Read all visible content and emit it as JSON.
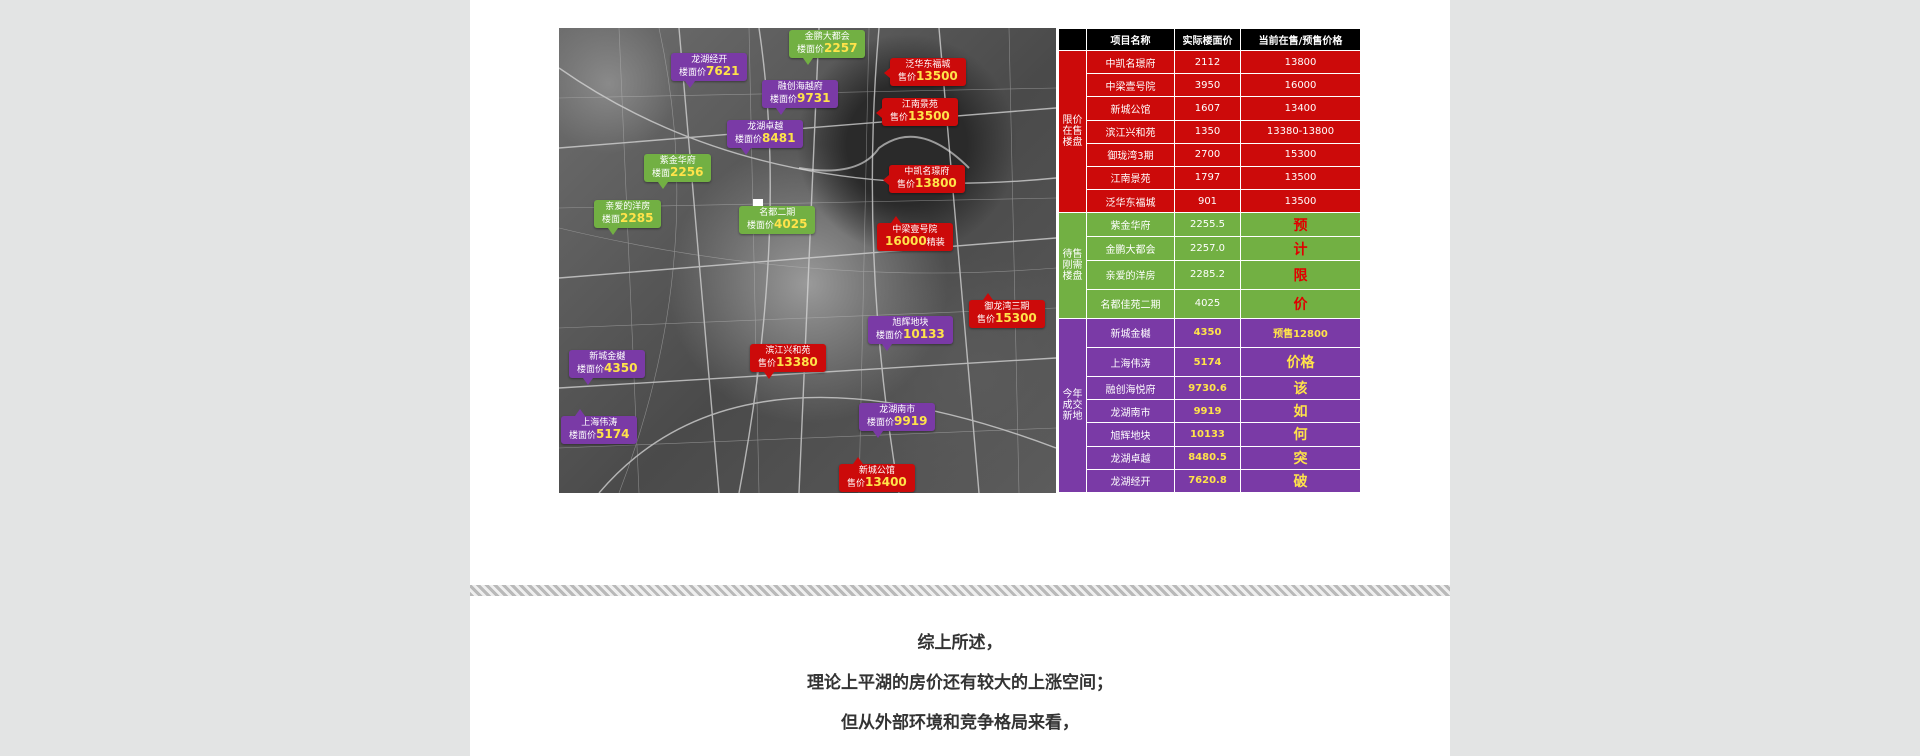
{
  "map": {
    "labels": {
      "jinpeng": {
        "name": "金鹏大都会",
        "value_prefix": "楼面价",
        "value": "2257"
      },
      "longhu_jingkai": {
        "name": "龙湖经开",
        "value_prefix": "楼面价",
        "value": "7621"
      },
      "fanhua": {
        "name": "泛华东福城",
        "value_prefix": "售价",
        "value": "13500"
      },
      "rongchuang": {
        "name": "融创海越府",
        "value_prefix": "楼面价",
        "value": "9731"
      },
      "jiangnan": {
        "name": "江南景苑",
        "value_prefix": "售价",
        "value": "13500"
      },
      "longhu_zhuoyue": {
        "name": "龙湖卓越",
        "value_prefix": "楼面价",
        "value": "8481"
      },
      "zijin": {
        "name": "紫金华府",
        "value_prefix": "楼面",
        "value": "2256"
      },
      "zhongfan": {
        "name": "中凯名璟府",
        "value_prefix": "售价",
        "value": "13800"
      },
      "qinai": {
        "name": "亲爱的洋房",
        "value_prefix": "楼面",
        "value": "2285"
      },
      "mingdu": {
        "name": "名都二期",
        "value_prefix": "楼面价",
        "value": "4025"
      },
      "zhongliang": {
        "name": "中梁壹号院",
        "value": "16000",
        "value_suffix": "精装"
      },
      "yulongwan": {
        "name": "御龙湾三期",
        "value_prefix": "售价",
        "value": "15300"
      },
      "xuhui": {
        "name": "旭辉地块",
        "value_prefix": "楼面价",
        "value": "10133"
      },
      "xincheng_jinye": {
        "name": "新城金樾",
        "value_prefix": "楼面价",
        "value": "4350"
      },
      "binjiang": {
        "name": "滨江兴和苑",
        "value_prefix": "售价",
        "value": "13380"
      },
      "shanghai": {
        "name": "上海伟涛",
        "value_prefix": "楼面价",
        "value": "5174"
      },
      "longhu_nanshi": {
        "name": "龙湖南市",
        "value_prefix": "楼面价",
        "value": "9919"
      },
      "xincheng_gongguan": {
        "name": "新城公馆",
        "value_prefix": "售价",
        "value": "13400"
      }
    }
  },
  "table": {
    "headers": [
      "项目名称",
      "实际楼面价",
      "当前在售/预售价格"
    ],
    "groups": {
      "limited": "限价在售楼盘",
      "pending": "待售刚需楼盘",
      "land": "今年成交新地"
    },
    "rows": [
      [
        "中凯名璟府",
        "2112",
        "13800"
      ],
      [
        "中梁壹号院",
        "3950",
        "16000"
      ],
      [
        "新城公馆",
        "1607",
        "13400"
      ],
      [
        "滨江兴和苑",
        "1350",
        "13380-13800"
      ],
      [
        "御珑湾3期",
        "2700",
        "15300"
      ],
      [
        "江南景苑",
        "1797",
        "13500"
      ],
      [
        "泛华东福城",
        "901",
        "13500"
      ],
      [
        "紫金华府",
        "2255.5",
        "预"
      ],
      [
        "金鹏大都会",
        "2257.0",
        "计"
      ],
      [
        "亲爱的洋房",
        "2285.2",
        "限"
      ],
      [
        "名都佳苑二期",
        "4025",
        "价"
      ],
      [
        "新城金樾",
        "4350",
        "预售12800"
      ],
      [
        "上海伟涛",
        "5174",
        "价格"
      ],
      [
        "融创海悦府",
        "9730.6",
        "该"
      ],
      [
        "龙湖南市",
        "9919",
        "如"
      ],
      [
        "旭辉地块",
        "10133",
        "何"
      ],
      [
        "龙湖卓越",
        "8480.5",
        "突"
      ],
      [
        "龙湖经开",
        "7620.8",
        "破"
      ]
    ]
  },
  "summary": [
    "综上所述，",
    "理论上平湖的房价还有较大的上涨空间；",
    "但从外部环境和竞争格局来看，"
  ]
}
